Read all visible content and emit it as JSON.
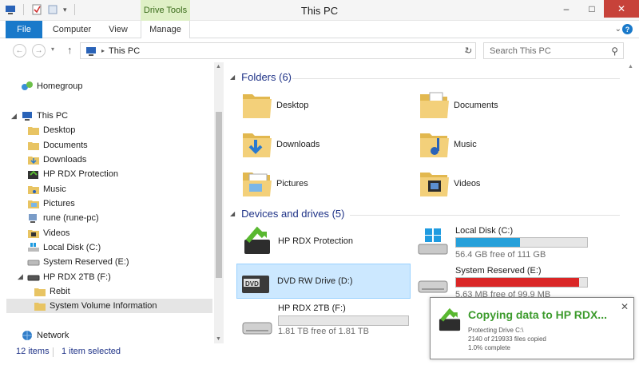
{
  "window": {
    "title": "This PC",
    "contextual_tab": "Drive Tools"
  },
  "ribbon": {
    "tabs": [
      "File",
      "Computer",
      "View",
      "Manage"
    ],
    "help": "?"
  },
  "address": {
    "crumb": "This PC",
    "search_placeholder": "Search This PC"
  },
  "nav": {
    "homegroup": "Homegroup",
    "thispc": "This PC",
    "items": [
      "Desktop",
      "Documents",
      "Downloads",
      "HP RDX Protection",
      "Music",
      "Pictures",
      "rune (rune-pc)",
      "Videos",
      "Local Disk (C:)",
      "System Reserved (E:)",
      "HP RDX 2TB (F:)",
      "Rebit",
      "System Volume Information"
    ],
    "network": "Network"
  },
  "folders": {
    "header": "Folders (6)",
    "items": [
      "Desktop",
      "Documents",
      "Downloads",
      "Music",
      "Pictures",
      "Videos"
    ]
  },
  "drives": {
    "header": "Devices and drives (5)",
    "items": [
      {
        "name": "HP RDX Protection",
        "free": "",
        "used_fraction": null
      },
      {
        "name": "Local Disk (C:)",
        "free": "56.4 GB free of 111 GB",
        "used_fraction": 0.49,
        "color": "#26a0da"
      },
      {
        "name": "DVD RW Drive (D:)",
        "free": "",
        "used_fraction": null
      },
      {
        "name": "System Reserved (E:)",
        "free": "5.63 MB free of 99.9 MB",
        "used_fraction": 0.94,
        "color": "#da2626"
      },
      {
        "name": "HP RDX 2TB (F:)",
        "free": "1.81 TB free of 1.81 TB",
        "used_fraction": 0.0,
        "color": "#26a0da"
      }
    ]
  },
  "status": {
    "items": "12 items",
    "selected": "1 item selected"
  },
  "notification": {
    "title": "Copying data to HP RDX...",
    "line1": "Protecting Drive C:\\",
    "line2": "2140 of 219933 files copied",
    "line3": "1.0% complete"
  }
}
